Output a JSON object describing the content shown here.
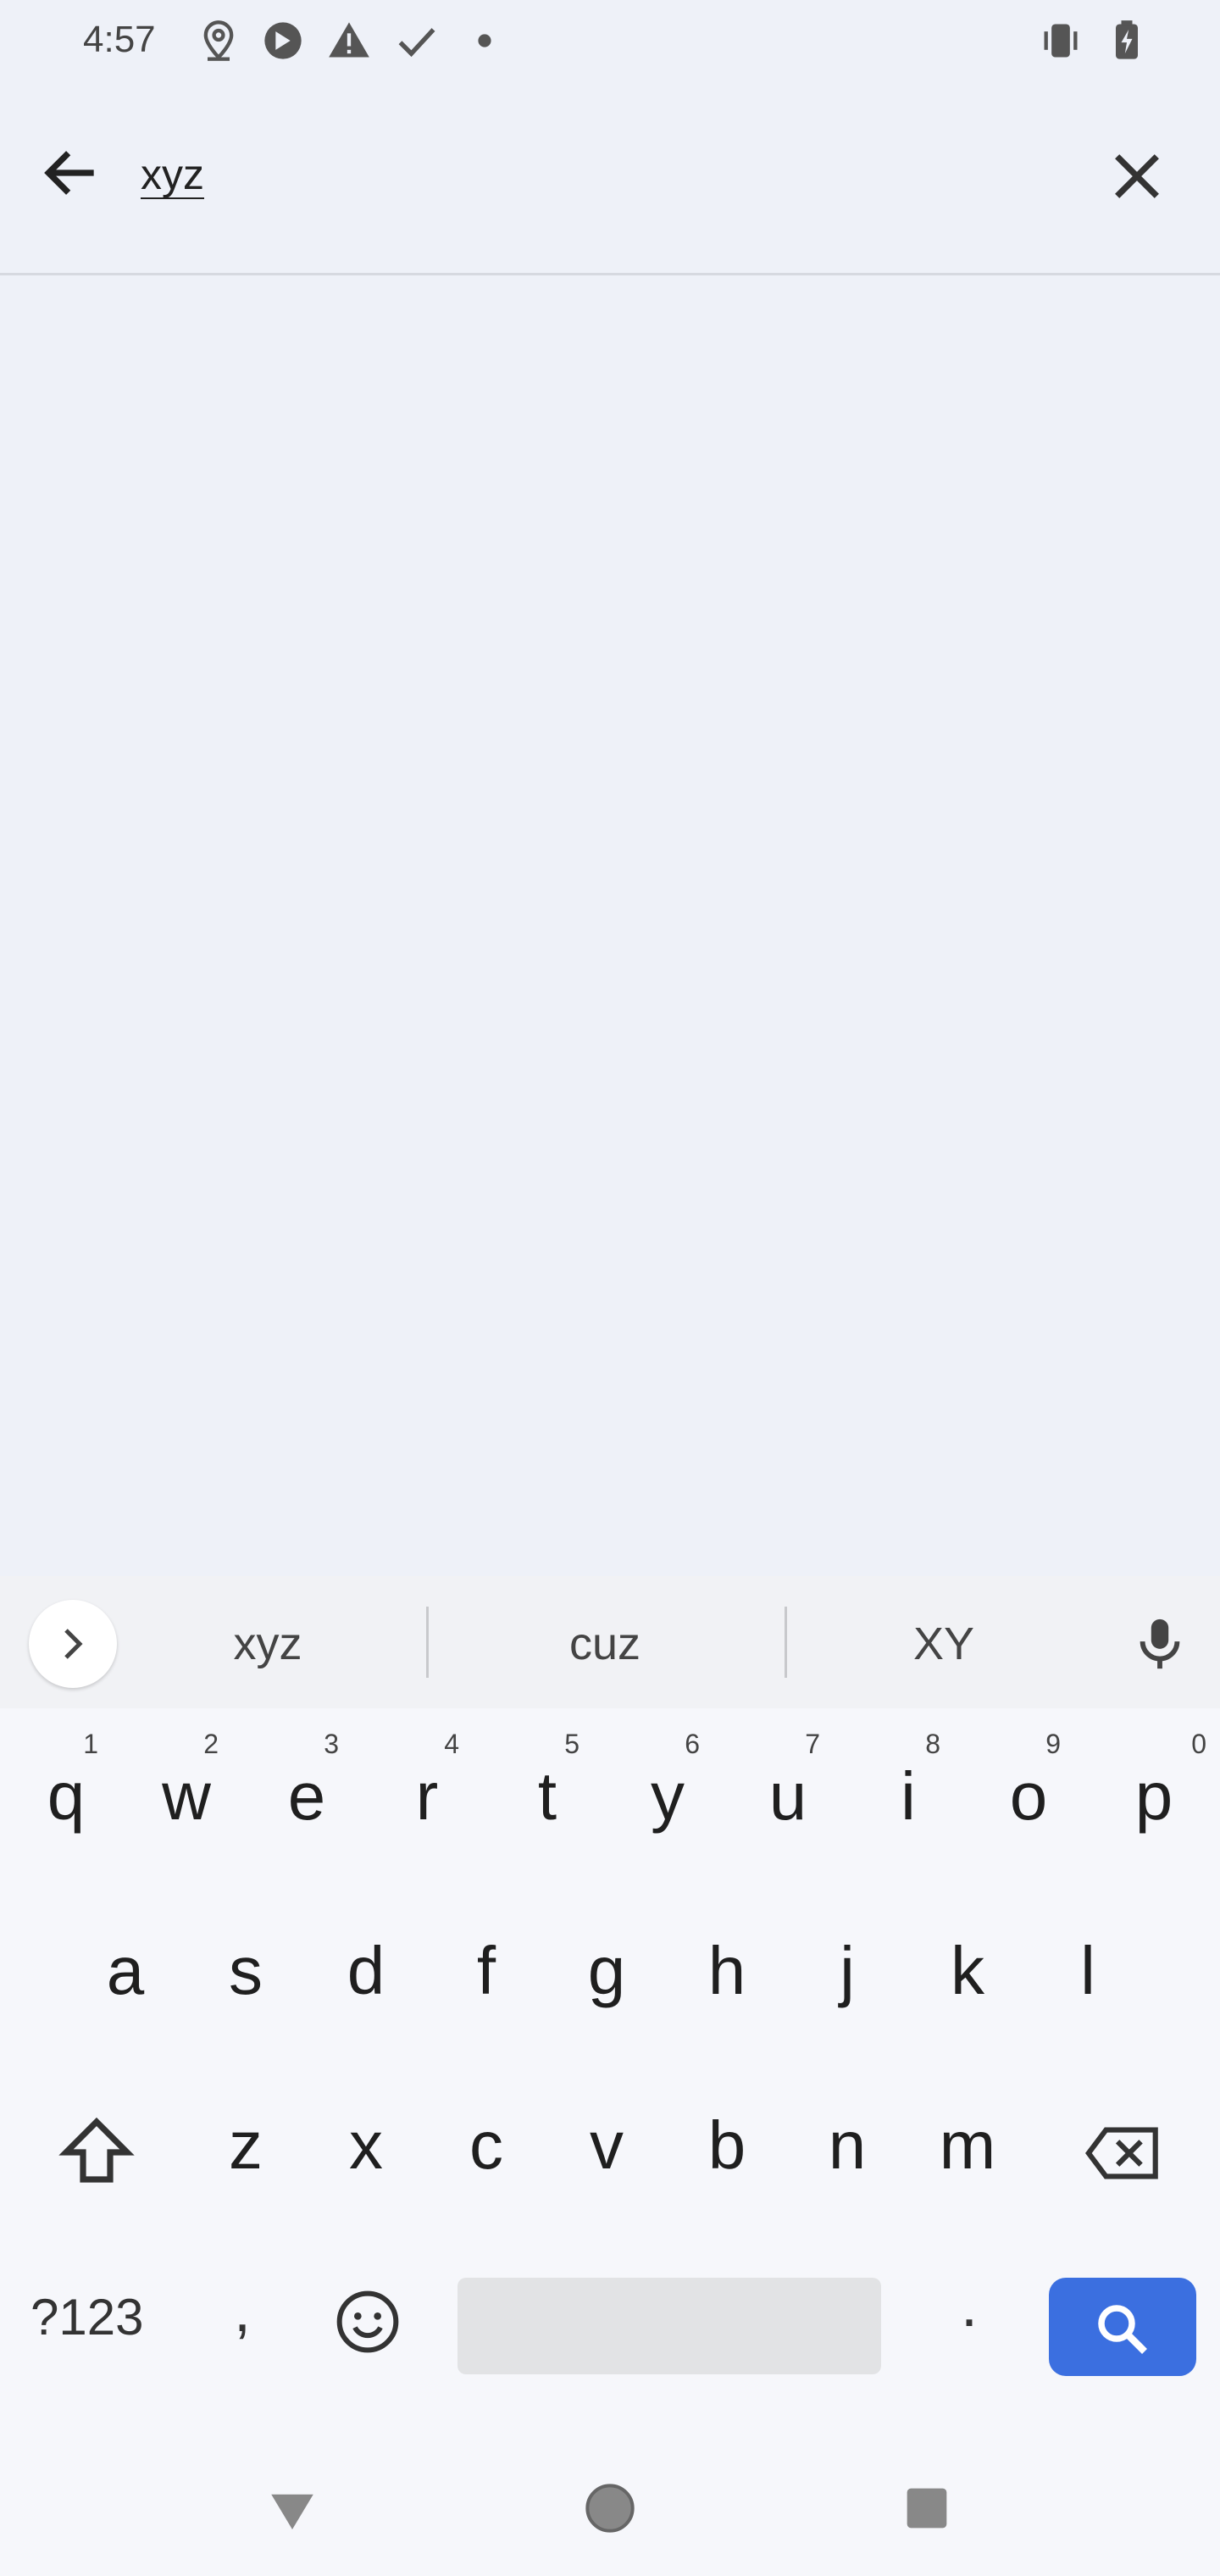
{
  "status_bar": {
    "time": "4:57",
    "icons": [
      "location-icon",
      "app-notification-icon",
      "warning-icon",
      "check-icon",
      "dot-icon",
      "vibrate-icon",
      "battery-charging-icon"
    ]
  },
  "search": {
    "query": "xyz",
    "back_icon": "arrow-left-icon",
    "clear_icon": "close-icon"
  },
  "keyboard": {
    "suggestions": [
      "xyz",
      "cuz",
      "XY"
    ],
    "row1": [
      {
        "letter": "q",
        "num": "1"
      },
      {
        "letter": "w",
        "num": "2"
      },
      {
        "letter": "e",
        "num": "3"
      },
      {
        "letter": "r",
        "num": "4"
      },
      {
        "letter": "t",
        "num": "5"
      },
      {
        "letter": "y",
        "num": "6"
      },
      {
        "letter": "u",
        "num": "7"
      },
      {
        "letter": "i",
        "num": "8"
      },
      {
        "letter": "o",
        "num": "9"
      },
      {
        "letter": "p",
        "num": "0"
      }
    ],
    "row2": [
      "a",
      "s",
      "d",
      "f",
      "g",
      "h",
      "j",
      "k",
      "l"
    ],
    "row3": [
      "z",
      "x",
      "c",
      "v",
      "b",
      "n",
      "m"
    ],
    "symbols_label": "?123",
    "comma_label": ",",
    "period_label": ".",
    "accent_color": "#3b6fe0"
  },
  "nav": {
    "back_icon": "nav-back-icon",
    "home_icon": "nav-home-icon",
    "recents_icon": "nav-recents-icon"
  }
}
